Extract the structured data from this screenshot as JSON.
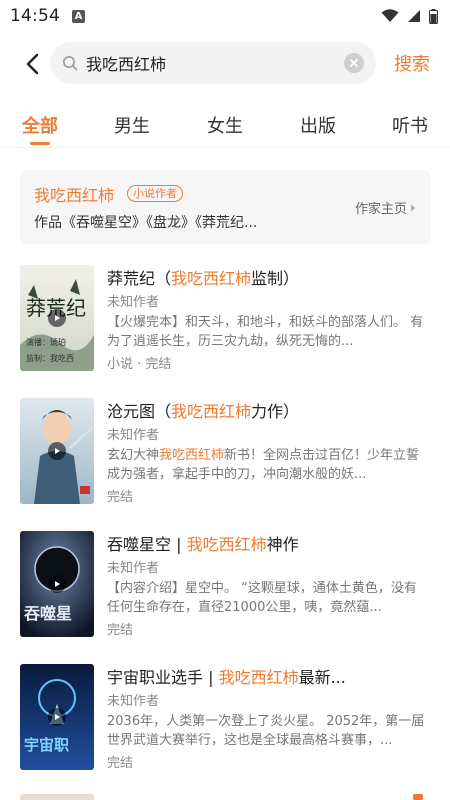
{
  "status_bar": {
    "time": "14:54",
    "app_icon": "A",
    "icons": [
      "wifi-icon",
      "signal-icon",
      "battery-icon"
    ]
  },
  "search": {
    "query": "我吃西红柿",
    "submit_label": "搜索"
  },
  "tabs": [
    {
      "label": "全部",
      "active": true
    },
    {
      "label": "男生",
      "active": false
    },
    {
      "label": "女生",
      "active": false
    },
    {
      "label": "出版",
      "active": false
    },
    {
      "label": "听书",
      "active": false
    }
  ],
  "author_card": {
    "name": "我吃西红柿",
    "badge": "小说作者",
    "works": "作品《吞噬星空》《盘龙》《莽荒纪...",
    "home_link": "作家主页"
  },
  "books": [
    {
      "title_plain": "莽荒纪（",
      "title_highlight": "我吃西红柿",
      "title_rest": "监制）",
      "author": "未知作者",
      "desc_plain": "",
      "desc_highlight": "",
      "desc_rest": "【火爆完本】和天斗，和地斗，和妖斗的部落人们。 有为了逍遥长生，历三灾九劫，纵死无悔的...",
      "meta": "小说 · 完结"
    },
    {
      "title_plain": "沧元图（",
      "title_highlight": "我吃西红柿",
      "title_rest": "力作）",
      "author": "未知作者",
      "desc_plain": "玄幻大神",
      "desc_highlight": "我吃西红柿",
      "desc_rest": "新书！全网点击过百亿！少年立誓成为强者，拿起手中的刀，冲向潮水般的妖...",
      "meta": "完结"
    },
    {
      "title_plain": "吞噬星空 | ",
      "title_highlight": "我吃西红柿",
      "title_rest": "神作",
      "author": "未知作者",
      "desc_plain": "",
      "desc_highlight": "",
      "desc_rest": "【内容介绍】星空中。 “这颗星球，通体土黄色，没有任何生命存在，直径21000公里，咦，竟然蕴...",
      "meta": "完结"
    },
    {
      "title_plain": "宇宙职业选手 | ",
      "title_highlight": "我吃西红柿",
      "title_rest": "最新...",
      "author": "未知作者",
      "desc_plain": "",
      "desc_highlight": "",
      "desc_rest": "2036年，人类第一次登上了炎火星。 2052年，第一届世界武道大赛举行，这也是全球最高格斗赛事，...",
      "meta": "完结"
    }
  ],
  "covers": [
    {
      "text": "莽荒纪",
      "small": "演播：琥珀",
      "bottom": "监制：我吃西"
    },
    {
      "text": "",
      "small": "",
      "bottom": ""
    },
    {
      "text": "吞噬星",
      "small": "",
      "bottom": ""
    },
    {
      "text": "宇宙职",
      "small": "",
      "bottom": ""
    }
  ],
  "colors": {
    "accent": "#f07b32",
    "text": "#222222",
    "secondary": "#888888",
    "card_bg": "#f6f6f6"
  }
}
